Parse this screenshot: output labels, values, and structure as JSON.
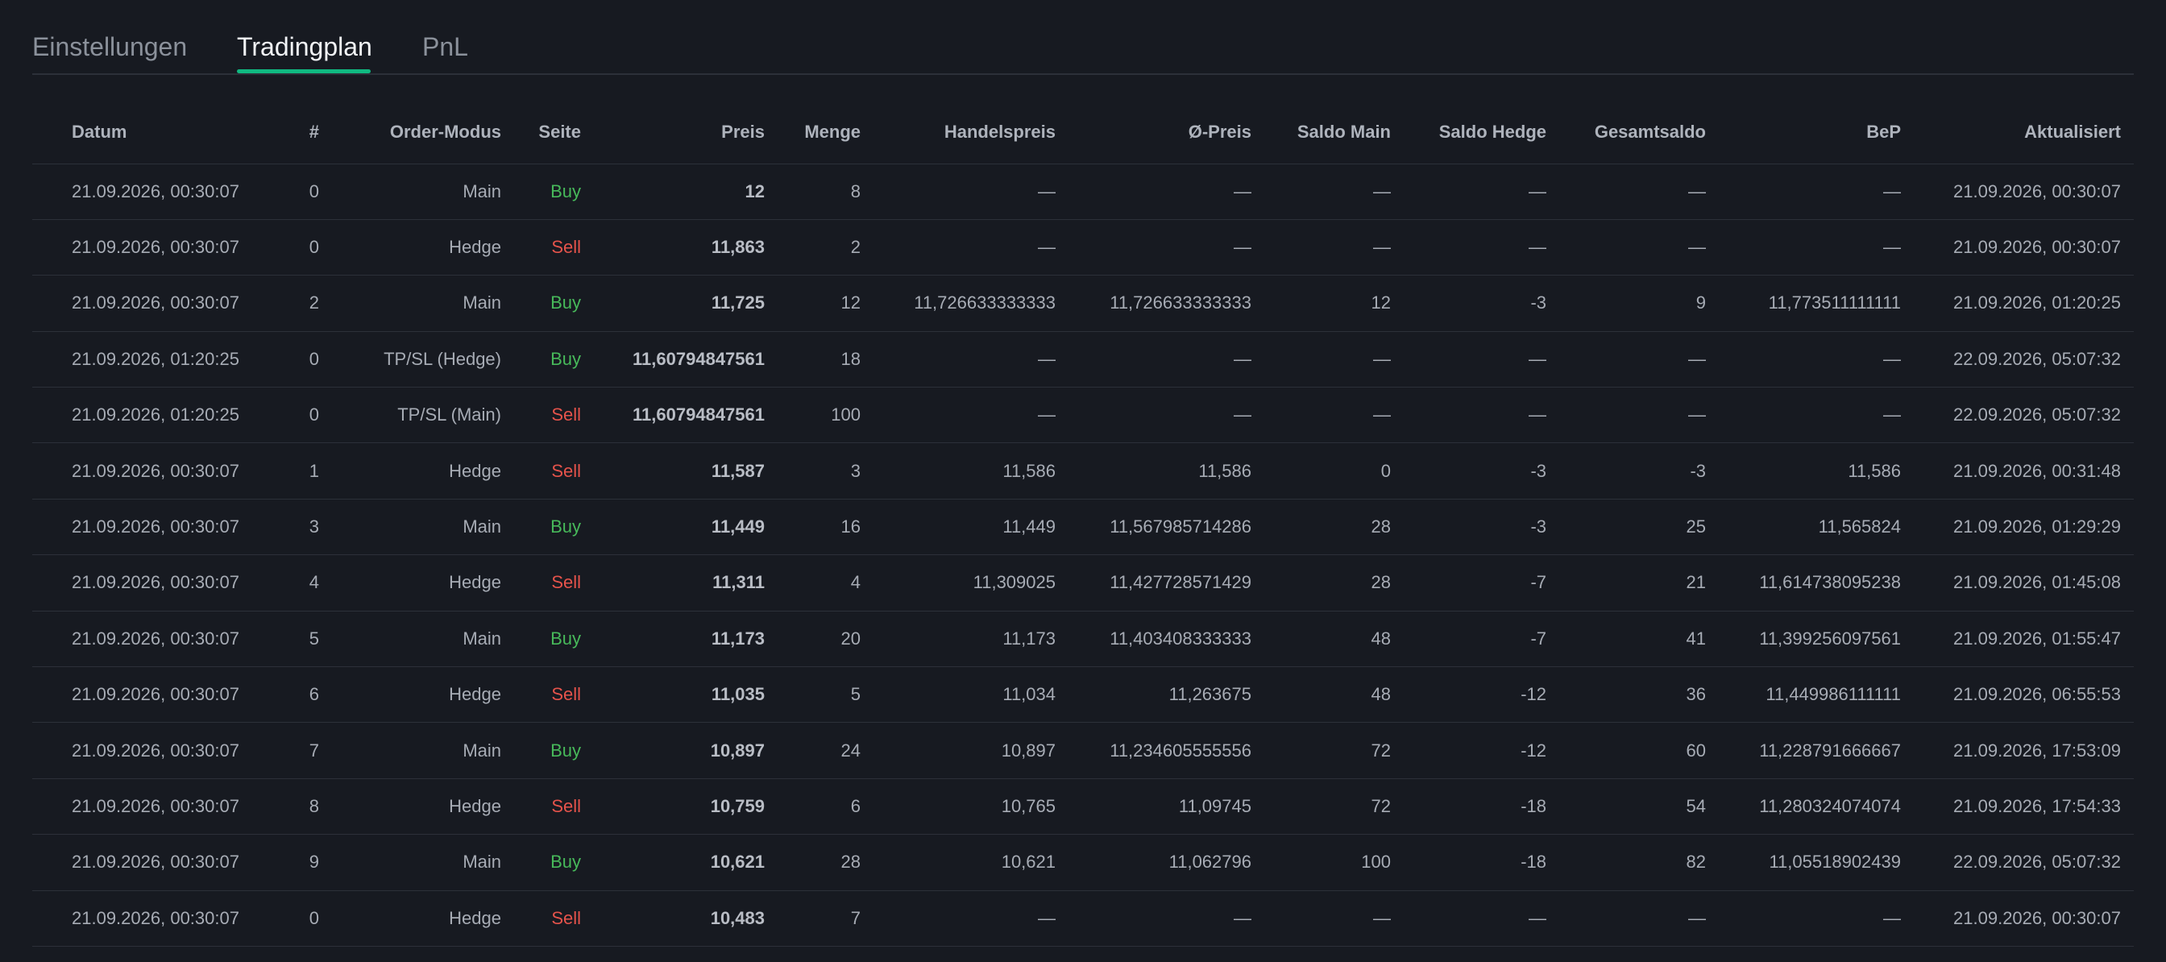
{
  "tabs": [
    {
      "label": "Einstellungen",
      "active": false
    },
    {
      "label": "Tradingplan",
      "active": true
    },
    {
      "label": "PnL",
      "active": false
    }
  ],
  "colors": {
    "background": "#171a21",
    "tab_active_underline": "#10b981",
    "buy": "#47b95a",
    "sell": "#e5534b",
    "text_muted": "#a7acb5",
    "divider": "#2c3039"
  },
  "table": {
    "columns": [
      "Datum",
      "#",
      "Order-Modus",
      "Seite",
      "Preis",
      "Menge",
      "Handelspreis",
      "Ø-Preis",
      "Saldo Main",
      "Saldo Hedge",
      "Gesamtsaldo",
      "BeP",
      "Aktualisiert"
    ],
    "rows": [
      [
        "21.09.2026, 00:30:07",
        "0",
        "Main",
        "Buy",
        "12",
        "8",
        "—",
        "—",
        "—",
        "—",
        "—",
        "—",
        "21.09.2026, 00:30:07"
      ],
      [
        "21.09.2026, 00:30:07",
        "0",
        "Hedge",
        "Sell",
        "11,863",
        "2",
        "—",
        "—",
        "—",
        "—",
        "—",
        "—",
        "21.09.2026, 00:30:07"
      ],
      [
        "21.09.2026, 00:30:07",
        "2",
        "Main",
        "Buy",
        "11,725",
        "12",
        "11,726633333333",
        "11,726633333333",
        "12",
        "-3",
        "9",
        "11,773511111111",
        "21.09.2026, 01:20:25"
      ],
      [
        "21.09.2026, 01:20:25",
        "0",
        "TP/SL (Hedge)",
        "Buy",
        "11,60794847561",
        "18",
        "—",
        "—",
        "—",
        "—",
        "—",
        "—",
        "22.09.2026, 05:07:32"
      ],
      [
        "21.09.2026, 01:20:25",
        "0",
        "TP/SL (Main)",
        "Sell",
        "11,60794847561",
        "100",
        "—",
        "—",
        "—",
        "—",
        "—",
        "—",
        "22.09.2026, 05:07:32"
      ],
      [
        "21.09.2026, 00:30:07",
        "1",
        "Hedge",
        "Sell",
        "11,587",
        "3",
        "11,586",
        "11,586",
        "0",
        "-3",
        "-3",
        "11,586",
        "21.09.2026, 00:31:48"
      ],
      [
        "21.09.2026, 00:30:07",
        "3",
        "Main",
        "Buy",
        "11,449",
        "16",
        "11,449",
        "11,567985714286",
        "28",
        "-3",
        "25",
        "11,565824",
        "21.09.2026, 01:29:29"
      ],
      [
        "21.09.2026, 00:30:07",
        "4",
        "Hedge",
        "Sell",
        "11,311",
        "4",
        "11,309025",
        "11,427728571429",
        "28",
        "-7",
        "21",
        "11,614738095238",
        "21.09.2026, 01:45:08"
      ],
      [
        "21.09.2026, 00:30:07",
        "5",
        "Main",
        "Buy",
        "11,173",
        "20",
        "11,173",
        "11,403408333333",
        "48",
        "-7",
        "41",
        "11,399256097561",
        "21.09.2026, 01:55:47"
      ],
      [
        "21.09.2026, 00:30:07",
        "6",
        "Hedge",
        "Sell",
        "11,035",
        "5",
        "11,034",
        "11,263675",
        "48",
        "-12",
        "36",
        "11,449986111111",
        "21.09.2026, 06:55:53"
      ],
      [
        "21.09.2026, 00:30:07",
        "7",
        "Main",
        "Buy",
        "10,897",
        "24",
        "10,897",
        "11,234605555556",
        "72",
        "-12",
        "60",
        "11,228791666667",
        "21.09.2026, 17:53:09"
      ],
      [
        "21.09.2026, 00:30:07",
        "8",
        "Hedge",
        "Sell",
        "10,759",
        "6",
        "10,765",
        "11,09745",
        "72",
        "-18",
        "54",
        "11,280324074074",
        "21.09.2026, 17:54:33"
      ],
      [
        "21.09.2026, 00:30:07",
        "9",
        "Main",
        "Buy",
        "10,621",
        "28",
        "10,621",
        "11,062796",
        "100",
        "-18",
        "82",
        "11,05518902439",
        "22.09.2026, 05:07:32"
      ],
      [
        "21.09.2026, 00:30:07",
        "0",
        "Hedge",
        "Sell",
        "10,483",
        "7",
        "—",
        "—",
        "—",
        "—",
        "—",
        "—",
        "21.09.2026, 00:30:07"
      ]
    ]
  }
}
